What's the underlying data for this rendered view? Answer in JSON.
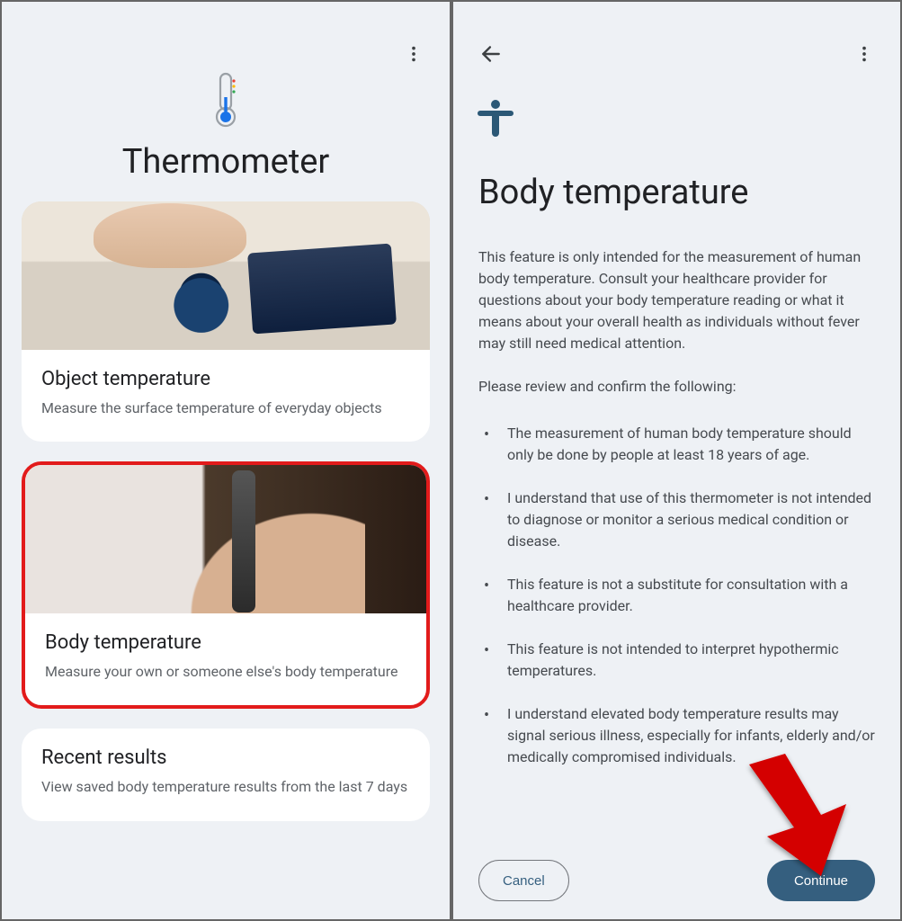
{
  "screen1": {
    "title": "Thermometer",
    "cards": {
      "object": {
        "title": "Object temperature",
        "desc": "Measure the surface temperature of everyday objects"
      },
      "body": {
        "title": "Body temperature",
        "desc": "Measure your own or someone else's body temperature"
      },
      "recent": {
        "title": "Recent results",
        "desc": "View saved body temperature results from the last 7 days"
      }
    }
  },
  "screen2": {
    "title": "Body temperature",
    "intro": "This feature is only intended for the measurement of human body temperature. Consult your healthcare provider for questions about your body temperature reading or what it means about your overall health as individuals without fever may still need medical attention.",
    "review_label": "Please review and confirm the following:",
    "bullets": [
      "The measurement of human body temperature should only be done by people at least 18 years of age.",
      "I understand that use of this thermometer is not intended to diagnose or monitor a serious medical condition or disease.",
      "This feature is not a substitute for consultation with a healthcare provider.",
      "This feature is not intended to interpret hypothermic temperatures.",
      "I understand elevated body temperature results may signal serious illness, especially for infants, elderly and/or medically compromised individuals."
    ],
    "buttons": {
      "cancel": "Cancel",
      "continue": "Continue"
    }
  },
  "colors": {
    "accent": "#355f7f",
    "highlight": "#e21b1b"
  }
}
